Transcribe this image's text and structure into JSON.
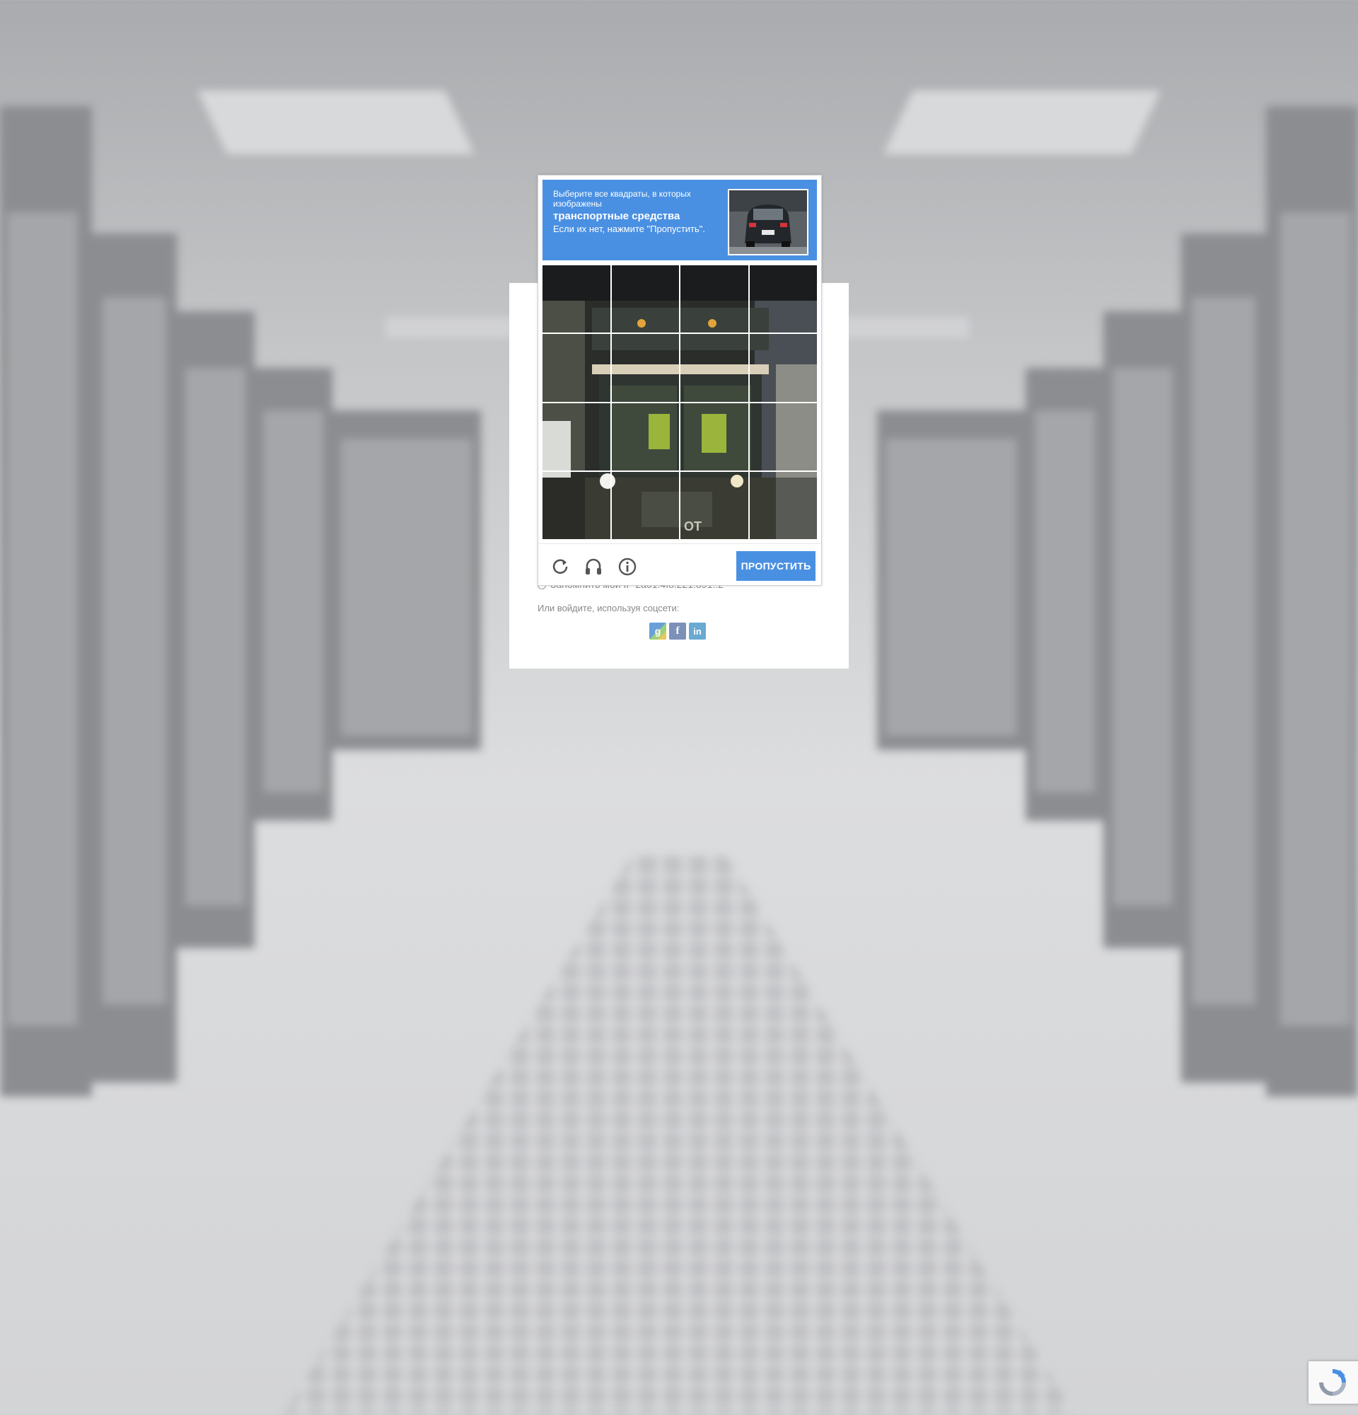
{
  "login": {
    "remember_text": "Запомнить мой IP 2a01:4f8:221:891::2",
    "social_label": "Или войдите, используя соцсети:",
    "social_google": "g",
    "social_facebook": "f",
    "social_linkedin": "in"
  },
  "captcha": {
    "instruction_sub": "Выберите все квадраты, в которых изображены",
    "instruction_main": "транспортные средства",
    "instruction_note": "Если их нет, нажмите \"Пропустить\".",
    "grid_tiles": 16,
    "skip_label": "ПРОПУСТИТЬ",
    "icons": [
      "reload-icon",
      "headphones-icon",
      "info-icon"
    ],
    "accent_color": "#4a90e2"
  }
}
